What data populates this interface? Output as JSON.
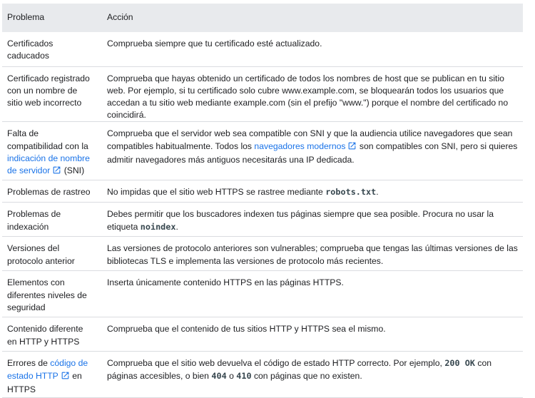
{
  "table": {
    "headers": [
      "Problema",
      "Acción"
    ],
    "rows": [
      {
        "problem": "Certificados caducados",
        "action": "Comprueba siempre que tu certificado esté actualizado."
      },
      {
        "problem": "Certificado registrado con un nombre de sitio web incorrecto",
        "action": "Comprueba que hayas obtenido un certificado de todos los nombres de host que se publican en tu sitio web. Por ejemplo, si tu certificado solo cubre www.example.com, se bloquearán todos los usuarios que accedan a tu sitio web mediante example.com (sin el prefijo \"www.\") porque el nombre del certificado no coincidirá."
      },
      {
        "problem_pre": "Falta de compatibilidad con la",
        "problem_link": "indicación de nombre de servidor",
        "problem_post": "(SNI)",
        "action_pre": "Comprueba que el servidor web sea compatible con SNI y que la audiencia utilice navegadores que sean compatibles habitualmente. Todos los",
        "action_link": "navegadores modernos",
        "action_post": "son compatibles con SNI, pero si quieres admitir navegadores más antiguos necesitarás una IP dedicada."
      },
      {
        "problem": "Problemas de rastreo",
        "action_pre": "No impidas que el sitio web HTTPS se rastree mediante",
        "action_code": "robots.txt",
        "action_post": "."
      },
      {
        "problem": "Problemas de indexación",
        "action_pre": "Debes permitir que los buscadores indexen tus páginas siempre que sea posible. Procura no usar la etiqueta",
        "action_code": "noindex",
        "action_post": "."
      },
      {
        "problem": "Versiones del protocolo anterior",
        "action": "Las versiones de protocolo anteriores son vulnerables; comprueba que tengas las últimas versiones de las bibliotecas TLS e implementa las versiones de protocolo más recientes."
      },
      {
        "problem": "Elementos con diferentes niveles de seguridad",
        "action": "Inserta únicamente contenido HTTPS en las páginas HTTPS."
      },
      {
        "problem": "Contenido diferente en HTTP y HTTPS",
        "action": "Comprueba que el contenido de tus sitios HTTP y HTTPS sea el mismo."
      },
      {
        "problem_pre": "Errores de",
        "problem_link": "código de estado HTTP",
        "problem_post": "en HTTPS",
        "action_pre": "Comprueba que el sitio web devuelva el código de estado HTTP correcto. Por ejemplo,",
        "action_code1": "200 OK",
        "action_mid1": "con páginas accesibles, o bien",
        "action_code2": "404",
        "action_mid2": "o",
        "action_code3": "410",
        "action_post": "con páginas que no existen."
      }
    ]
  },
  "icons": {
    "external_link": "external-link-icon"
  },
  "colors": {
    "link": "#1a73e8",
    "header_bg": "#e8eaed",
    "border": "#dadce0",
    "text": "#202124"
  }
}
